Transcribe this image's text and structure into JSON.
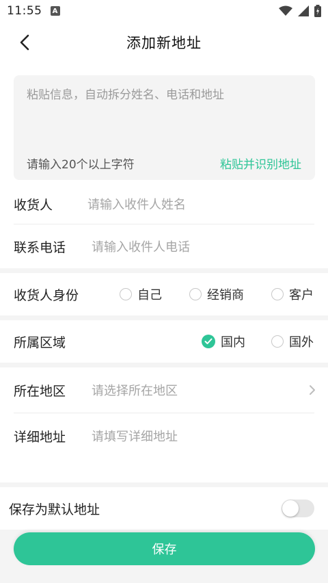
{
  "status_bar": {
    "time": "11:55",
    "notification": "A"
  },
  "header": {
    "title": "添加新地址"
  },
  "paste": {
    "placeholder": "粘贴信息，自动拆分姓名、电话和地址",
    "hint": "请输入20个以上字符",
    "action": "粘贴并识别地址"
  },
  "consignee": {
    "label": "收货人",
    "placeholder": "请输入收件人姓名"
  },
  "phone": {
    "label": "联系电话",
    "placeholder": "请输入收件人电话"
  },
  "identity": {
    "label": "收货人身份",
    "options": [
      "自己",
      "经销商",
      "客户"
    ],
    "selected": null
  },
  "region_type": {
    "label": "所属区域",
    "options": [
      "国内",
      "国外"
    ],
    "selected": "国内"
  },
  "area": {
    "label": "所在地区",
    "placeholder": "请选择所在地区"
  },
  "detail": {
    "label": "详细地址",
    "placeholder": "请填写详细地址"
  },
  "default_address": {
    "label": "保存为默认地址",
    "enabled": false
  },
  "save_button": {
    "label": "保存"
  },
  "colors": {
    "accent": "#2ec597"
  }
}
